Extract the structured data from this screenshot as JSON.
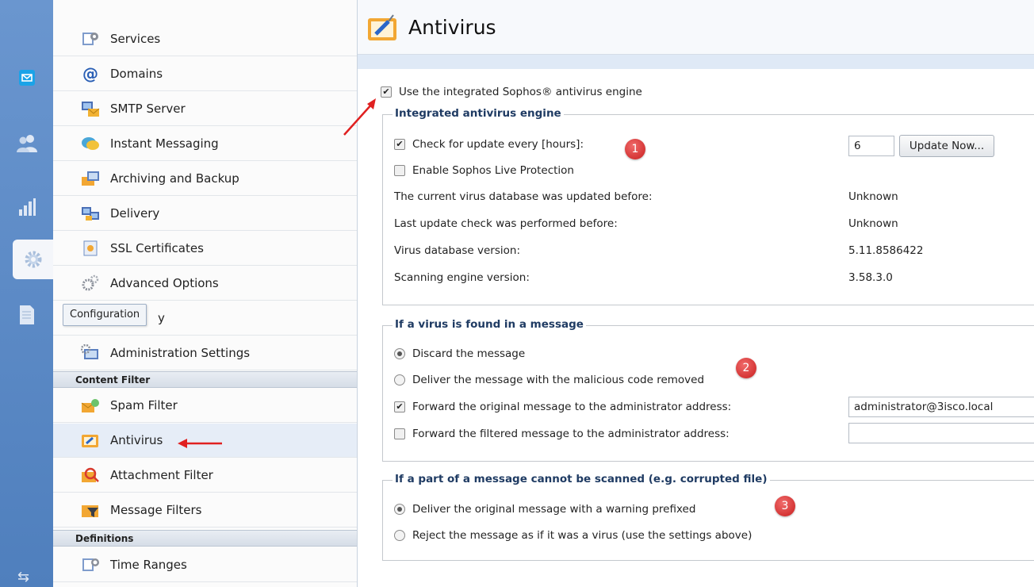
{
  "rail": {
    "items": [
      {
        "name": "mail-icon"
      },
      {
        "name": "users-icon"
      },
      {
        "name": "stats-icon"
      },
      {
        "name": "gear-icon"
      },
      {
        "name": "document-icon"
      }
    ],
    "bottom_glyph": "⇆"
  },
  "tooltip": "Configuration",
  "nav": {
    "items": [
      {
        "label": "Services",
        "icon": "services-icon"
      },
      {
        "label": "Domains",
        "icon": "at-icon"
      },
      {
        "label": "SMTP Server",
        "icon": "smtp-icon"
      },
      {
        "label": "Instant Messaging",
        "icon": "chat-icon"
      },
      {
        "label": "Archiving and Backup",
        "icon": "archive-icon"
      },
      {
        "label": "Delivery",
        "icon": "delivery-icon"
      },
      {
        "label": "SSL Certificates",
        "icon": "certificate-icon"
      },
      {
        "label": "Advanced Options",
        "icon": "advanced-icon"
      },
      {
        "label": "y",
        "icon": "security-icon"
      },
      {
        "label": "Administration Settings",
        "icon": "admin-icon"
      }
    ],
    "section_content_filter": "Content Filter",
    "content_filter_items": [
      {
        "label": "Spam Filter",
        "icon": "spam-icon"
      },
      {
        "label": "Antivirus",
        "icon": "antivirus-icon"
      },
      {
        "label": "Attachment Filter",
        "icon": "attachment-icon"
      },
      {
        "label": "Message Filters",
        "icon": "message-filter-icon"
      }
    ],
    "section_definitions": "Definitions",
    "definitions_items": [
      {
        "label": "Time Ranges",
        "icon": "time-icon"
      }
    ]
  },
  "page": {
    "title": "Antivirus",
    "use_engine_label": "Use the integrated Sophos® antivirus engine",
    "use_engine_checked": true,
    "engine_group": {
      "legend": "Integrated antivirus engine",
      "check_update_label": "Check for update every [hours]:",
      "check_update_checked": true,
      "check_update_hours": "6",
      "update_now_button": "Update Now...",
      "live_protection_label": "Enable Sophos Live Protection",
      "live_protection_checked": false,
      "info_rows": [
        {
          "label": "The current virus database was updated before:",
          "value": "Unknown"
        },
        {
          "label": "Last update check was performed before:",
          "value": "Unknown"
        },
        {
          "label": "Virus database version:",
          "value": "5.11.8586422"
        },
        {
          "label": "Scanning engine version:",
          "value": "3.58.3.0"
        }
      ]
    },
    "virus_group": {
      "legend": "If a virus is found in a message",
      "discard_label": "Discard the message",
      "deliver_removed_label": "Deliver the message with the malicious code removed",
      "selected_option": "Discard the message",
      "forward_original_label": "Forward the original message to the administrator address:",
      "forward_original_checked": true,
      "forward_original_value": "administrator@3isco.local",
      "forward_filtered_label": "Forward the filtered message to the administrator address:",
      "forward_filtered_checked": false,
      "forward_filtered_value": ""
    },
    "unscannable_group": {
      "legend": "If a part of a message cannot be scanned (e.g. corrupted file)",
      "deliver_warning_label": "Deliver the original message with a warning prefixed",
      "reject_label": "Reject the message as if it was a virus (use the settings above)",
      "selected_option": "Deliver the original message with a warning prefixed"
    },
    "badges": [
      "1",
      "2",
      "3"
    ]
  },
  "colors": {
    "rail": "#5b88c4",
    "legend_text": "#1f3b63",
    "badge": "#d22a2a",
    "annotation_arrow": "#e02020"
  }
}
